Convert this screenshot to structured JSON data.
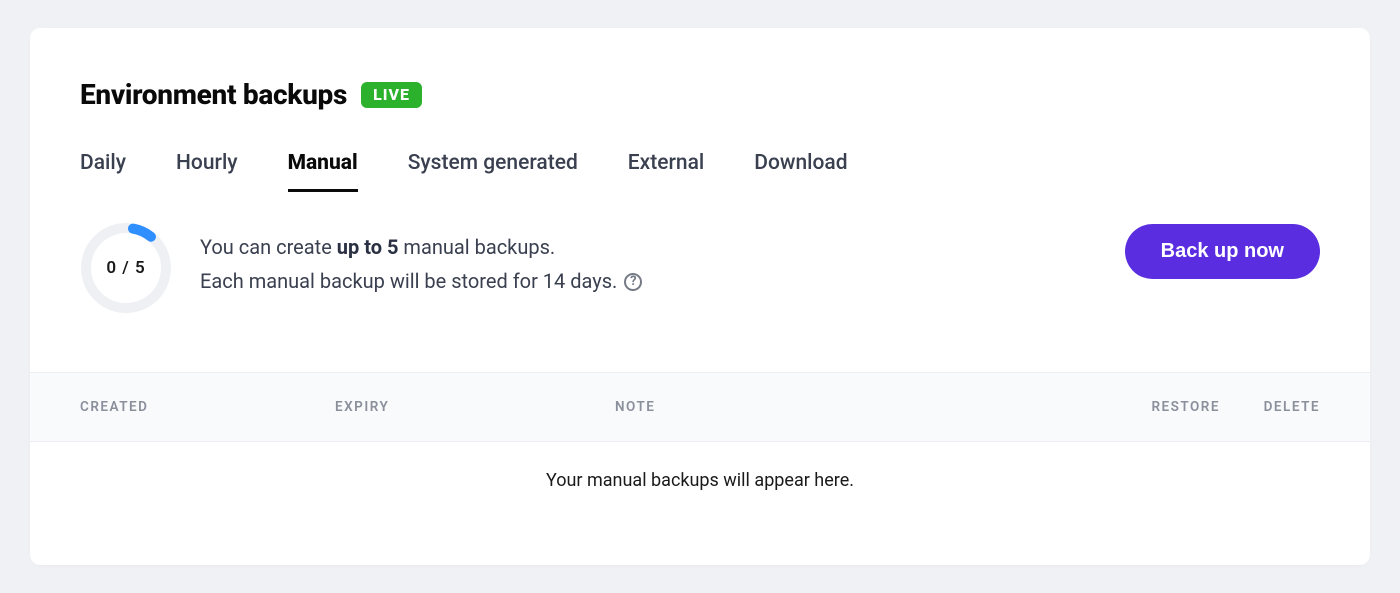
{
  "header": {
    "title": "Environment backups",
    "badge": "LIVE"
  },
  "tabs": {
    "daily": "Daily",
    "hourly": "Hourly",
    "manual": "Manual",
    "system": "System generated",
    "external": "External",
    "download": "Download",
    "active": "manual"
  },
  "gauge": {
    "label": "0 / 5"
  },
  "info": {
    "line1_pre": "You can create ",
    "line1_strong": "up to 5",
    "line1_post": " manual backups.",
    "line2": "Each manual backup will be stored for 14 days."
  },
  "actions": {
    "backup_now": "Back up now"
  },
  "table": {
    "columns": {
      "created": "CREATED",
      "expiry": "EXPIRY",
      "note": "NOTE",
      "restore": "RESTORE",
      "delete": "DELETE"
    },
    "empty_message": "Your manual backups will appear here."
  }
}
